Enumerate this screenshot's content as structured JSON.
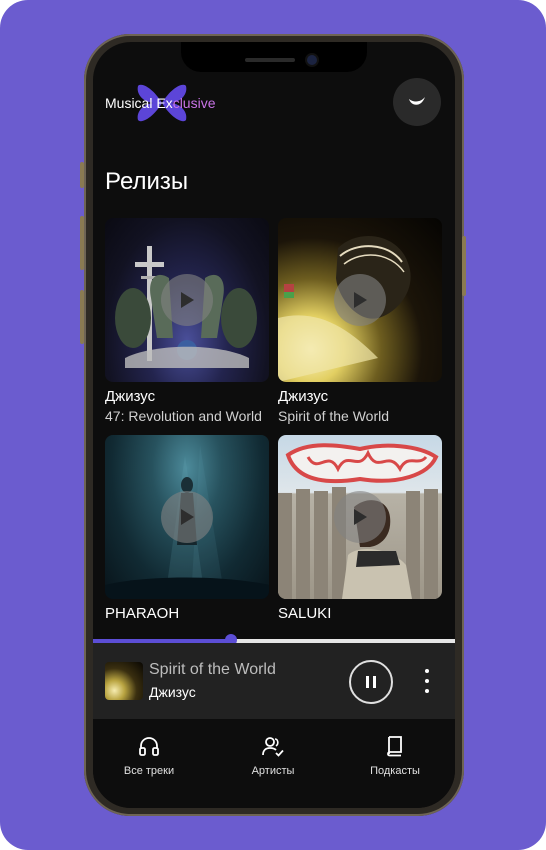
{
  "app": {
    "logo_text_main": "Musical Ex",
    "logo_text_accent": "clusive"
  },
  "section": {
    "title": "Релизы"
  },
  "releases": [
    {
      "artist": "Джизус",
      "title": "47: Revolution and World",
      "cover": "cross-angels-art"
    },
    {
      "artist": "Джизус",
      "title": "Spirit of the World",
      "cover": "light-portrait-art"
    },
    {
      "artist": "PHARAOH",
      "title": "",
      "cover": "underwater-figure-art"
    },
    {
      "artist": "SALUKI",
      "title": "",
      "cover": "fence-portrait-art"
    }
  ],
  "player": {
    "title": "Spirit of the World",
    "artist": "Джизус",
    "progress": 0.38
  },
  "nav": [
    {
      "label": "Все треки",
      "icon": "headphones-icon"
    },
    {
      "label": "Артисты",
      "icon": "artists-icon"
    },
    {
      "label": "Подкасты",
      "icon": "book-icon"
    }
  ],
  "colors": {
    "background": "#6b5ccf",
    "accent": "#5c4ed6",
    "logo_accent": "#c873e6"
  }
}
